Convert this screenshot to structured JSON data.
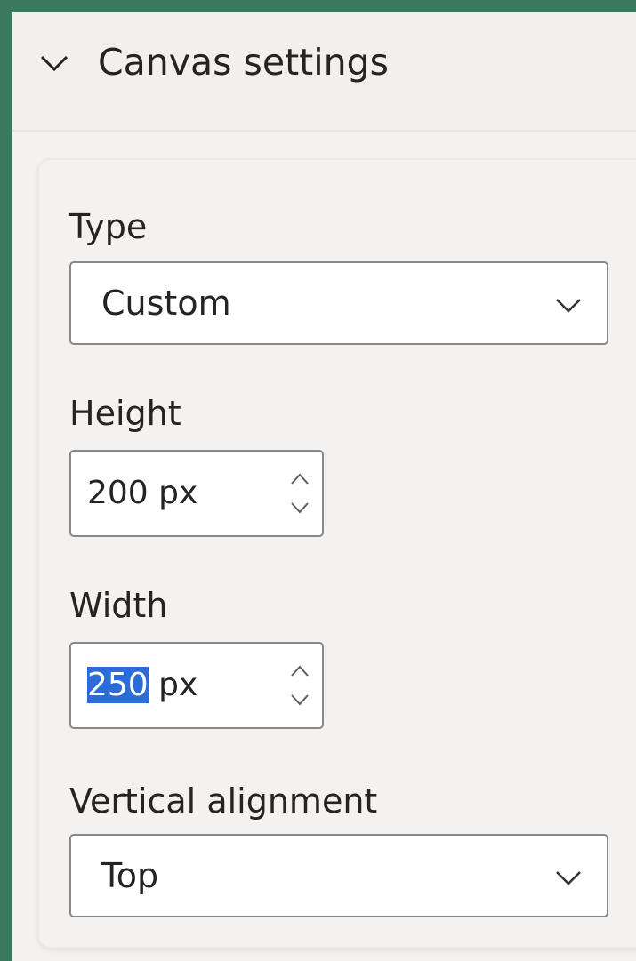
{
  "section": {
    "title": "Canvas settings",
    "expanded_icon": "chevron-down-icon"
  },
  "type_field": {
    "label": "Type",
    "value": "Custom",
    "icon": "chevron-down-icon"
  },
  "height_field": {
    "label": "Height",
    "number": "200",
    "unit": " px",
    "icons": [
      "chevron-up-icon",
      "chevron-down-icon"
    ]
  },
  "width_field": {
    "label": "Width",
    "number": "250",
    "unit": " px",
    "number_selected": true,
    "icons": [
      "chevron-up-icon",
      "chevron-down-icon"
    ]
  },
  "vertical_alignment_field": {
    "label": "Vertical alignment",
    "value": "Top",
    "icon": "chevron-down-icon"
  },
  "colors": {
    "frame": "#3a7a5a",
    "panel_bg": "#f3f2f1",
    "input_bg": "#ffffff",
    "input_border": "#8a8886",
    "text": "#252423",
    "selection": "#2b6cd8"
  }
}
